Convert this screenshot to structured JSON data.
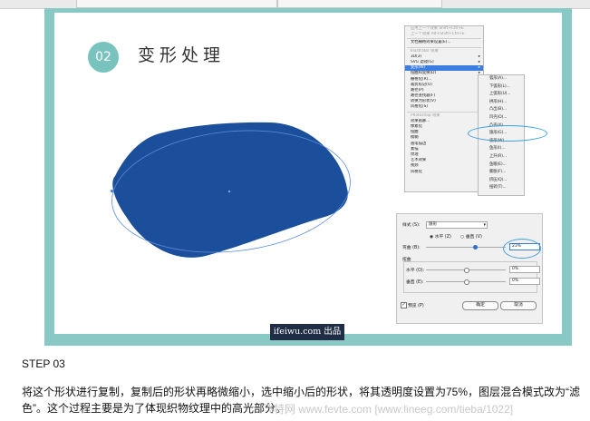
{
  "slide": {
    "number": "02",
    "title": "变形处理"
  },
  "menu": {
    "items": [
      {
        "label": "应用上一个效果   Shift+Ctrl+E",
        "style": "gray"
      },
      {
        "label": "上一个效果   Alt+Shift+Ctrl+E",
        "style": "gray"
      },
      {
        "sep": true
      },
      {
        "label": "文档栅格效果设置(E)...",
        "style": ""
      },
      {
        "sep": true
      },
      {
        "label": "Illustrator 效果",
        "style": "gray"
      },
      {
        "label": "3D(3)",
        "style": "arr"
      },
      {
        "label": "SVG 滤镜(G)",
        "style": "arr"
      },
      {
        "label": "变形(W)",
        "style": "hl arr"
      },
      {
        "label": "扭曲和变换(D)",
        "style": "arr"
      },
      {
        "label": "栅格化(R)...",
        "style": ""
      },
      {
        "label": "裁剪标记(O)",
        "style": ""
      },
      {
        "label": "路径(P)",
        "style": "arr"
      },
      {
        "label": "路径查找器(F)",
        "style": "arr"
      },
      {
        "label": "转换为形状(V)",
        "style": "arr"
      },
      {
        "label": "风格化(S)",
        "style": "arr"
      },
      {
        "sep": true
      },
      {
        "label": "Photoshop 效果",
        "style": "gray"
      },
      {
        "label": "效果画廊...",
        "style": ""
      },
      {
        "label": "像素化",
        "style": "arr"
      },
      {
        "label": "扭曲",
        "style": "arr"
      },
      {
        "label": "模糊",
        "style": "arr"
      },
      {
        "label": "画笔描边",
        "style": "arr"
      },
      {
        "label": "素描",
        "style": "arr"
      },
      {
        "label": "纹理",
        "style": "arr"
      },
      {
        "label": "艺术效果",
        "style": "arr"
      },
      {
        "label": "视频",
        "style": "arr"
      },
      {
        "label": "风格化",
        "style": "arr"
      }
    ]
  },
  "submenu": {
    "items": [
      "弧形(A)...",
      "下弧形(L)...",
      "上弧形(U)...",
      "拱形(H)...",
      "凸出(B)...",
      "凹壳(O)...",
      "凸壳(X)...",
      "旗形(G)...",
      "波形(W)...",
      "鱼形(I)...",
      "上升(R)...",
      "鱼眼(E)...",
      "膨胀(F)...",
      "挤压(Q)...",
      "扭转(T)..."
    ]
  },
  "dialog": {
    "style_label": "样式 (S):",
    "style_value": "旗形",
    "horizontal_label": "水平 (Z)",
    "vertical_label": "垂直 (V)",
    "bend_label": "弯曲 (B):",
    "bend_value": "23%",
    "bend_fraction": 0.23,
    "distortion_label": "扭曲",
    "horiz_dist_label": "水平 (O):",
    "horiz_dist_value": "0%",
    "vert_dist_label": "垂直 (E):",
    "vert_dist_value": "0%",
    "preview_label": "预览 (P)",
    "ok_label": "确定",
    "cancel_label": "取消"
  },
  "watermark": "ifeiwu.com 出品",
  "step_title": "STEP 03",
  "paragraph": "将这个形状进行复制，复制后的形状再略微缩小，选中缩小后的形状，将其透明度设置为75%，图层混合模式改为“滤色”。这个过程主要是为了体现织物纹理中的高光部分。",
  "forum_watermark": "飞特网 www.fevte.com   [www.lineeg.com/tieba/1022]",
  "colors": {
    "frame": "#88c9c6",
    "circle": "#79c3bf",
    "shape_fill": "#1b4f9b",
    "highlight_ring": "#3fa1e0",
    "menu_highlight": "#3b7de0"
  }
}
